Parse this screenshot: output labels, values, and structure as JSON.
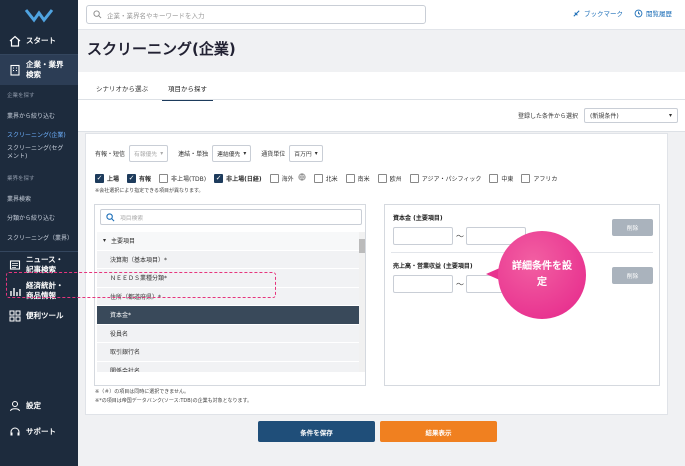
{
  "sidebar": {
    "nav": {
      "start": "スタート",
      "company_search": "企業・業界検索",
      "news": "ニュース・記事検索",
      "economy": "経済統計・商品情報",
      "tools": "便利ツール",
      "settings": "設定",
      "support": "サポート"
    },
    "sections": {
      "find_company": "企業を探す",
      "find_industry": "業界を探す"
    },
    "company_items": [
      "業界から絞り込む",
      "スクリーニング(企業)",
      "スクリーニング(セグメント)"
    ],
    "industry_items": [
      "業界検索",
      "分類から絞り込む",
      "スクリーニング（業界）"
    ]
  },
  "topbar": {
    "search_placeholder": "企業・業界名やキーワードを入力",
    "bookmark": "ブックマーク",
    "history": "閲覧履歴"
  },
  "page": {
    "title": "スクリーニング(企業)",
    "tabs": [
      "シナリオから選ぶ",
      "項目から探す"
    ],
    "saved_label": "登録した条件から選択",
    "saved_value": "(新規条件)"
  },
  "options": {
    "fiscal_label": "有報・短信",
    "fiscal_value": "有報優先",
    "consol_label": "連結・単独",
    "consol_value": "連結優先",
    "unit_label": "通貨単位",
    "unit_value": "百万円"
  },
  "markets": [
    {
      "label": "上場",
      "checked": true
    },
    {
      "label": "有報",
      "checked": true
    },
    {
      "label": "非上場(TDB)",
      "checked": false
    },
    {
      "label": "非上場(日経)",
      "checked": true
    },
    {
      "label": "海外",
      "checked": false
    },
    {
      "label": "北米",
      "checked": false
    },
    {
      "label": "南米",
      "checked": false
    },
    {
      "label": "欧州",
      "checked": false
    },
    {
      "label": "アジア・パシフィック",
      "checked": false
    },
    {
      "label": "中東",
      "checked": false
    },
    {
      "label": "アフリカ",
      "checked": false
    }
  ],
  "market_note": "※会社選択により指定できる項目が異なります。",
  "item_search_placeholder": "項目検索",
  "tree": {
    "group": "主要項目",
    "items": [
      "決算期（基本項目）*",
      "ＮＥＥＤＳ業種分類*",
      "住所（都道府県）*",
      "資本金*",
      "役員名",
      "取引銀行名",
      "関係会社名"
    ]
  },
  "conditions": [
    {
      "label": "資本金 (主要項目)",
      "delete": "削除"
    },
    {
      "label": "売上高・営業収益 (主要項目)",
      "delete": "削除"
    }
  ],
  "tilde": "～",
  "callout": "詳細条件を設定",
  "notes": [
    "※（＃）の項目は同時に選択できません。",
    "※*の項目は帝国データバンク(ソース:TDB)の企業も対象となります。"
  ],
  "buttons": {
    "save": "条件を保存",
    "show": "結果表示"
  },
  "colors": {
    "sidebar": "#1d2b3d",
    "save": "#1f4e79",
    "show": "#f08020",
    "callout": "#e5258a"
  }
}
